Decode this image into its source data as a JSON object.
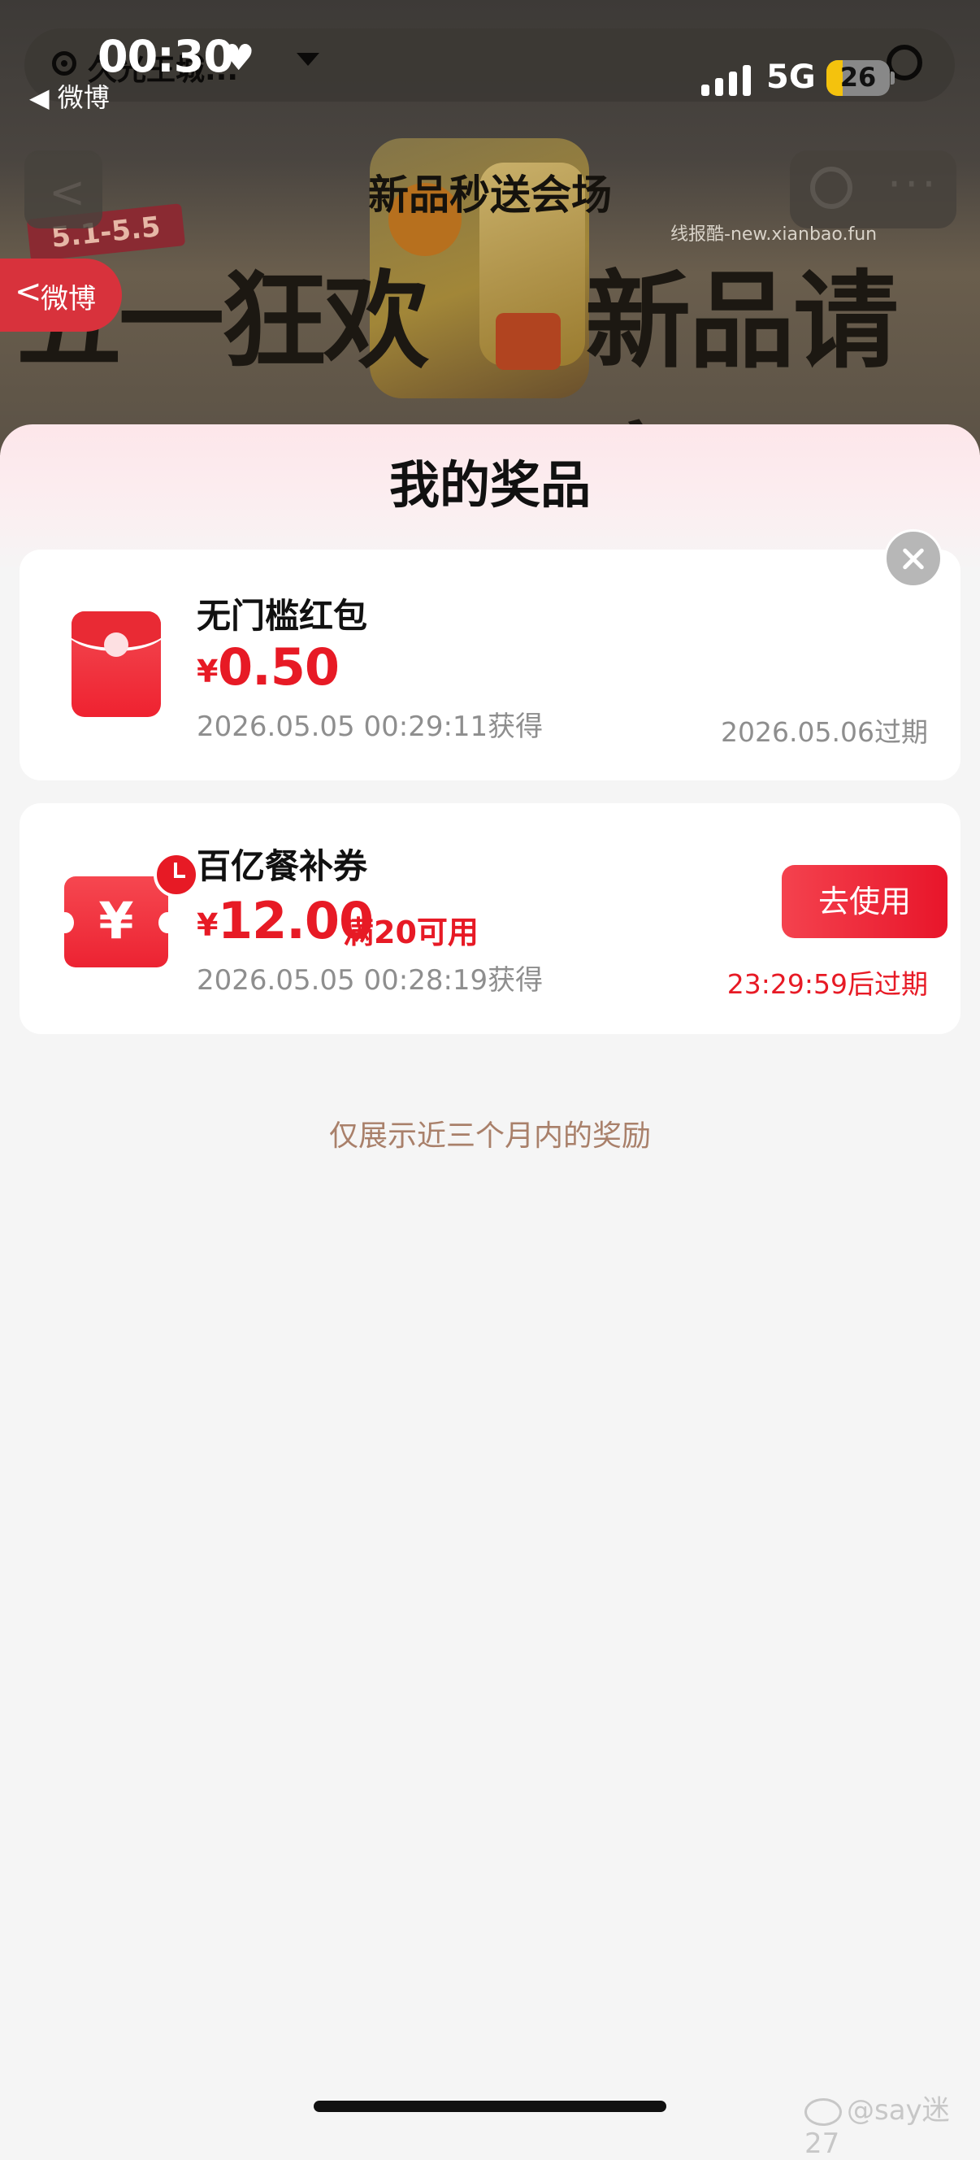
{
  "status_bar": {
    "time": "00:30",
    "back_app": "◀ 微博",
    "network": "5G",
    "battery": "26",
    "battery_level": 0.26
  },
  "background_page": {
    "location_name": "久光王城...",
    "title": "新品秒送会场",
    "banner_left": "五一狂欢",
    "banner_right": "新品请客",
    "banner_date": "5.1-5.5",
    "watermark": "线报酷-new.xianbao.fun"
  },
  "weibo_return": {
    "label": "微博"
  },
  "prize_sheet": {
    "title": "我的奖品",
    "prizes": [
      {
        "name": "无门槛红包",
        "currency": "¥",
        "amount": "0.50",
        "obtained": "2026.05.05 00:29:11获得",
        "expiry": "2026.05.06过期"
      },
      {
        "name": "百亿餐补券",
        "currency": "¥",
        "amount": "12.00",
        "condition": "满20可用",
        "obtained": "2026.05.05 00:28:19获得",
        "expiry": "23:29:59后过期",
        "action": "去使用"
      }
    ],
    "footnote": "仅展示近三个月内的奖励"
  },
  "watermark_bottom": "@say迷27",
  "colors": {
    "accent_red": "#e71a25",
    "footnote": "#a9806a"
  }
}
